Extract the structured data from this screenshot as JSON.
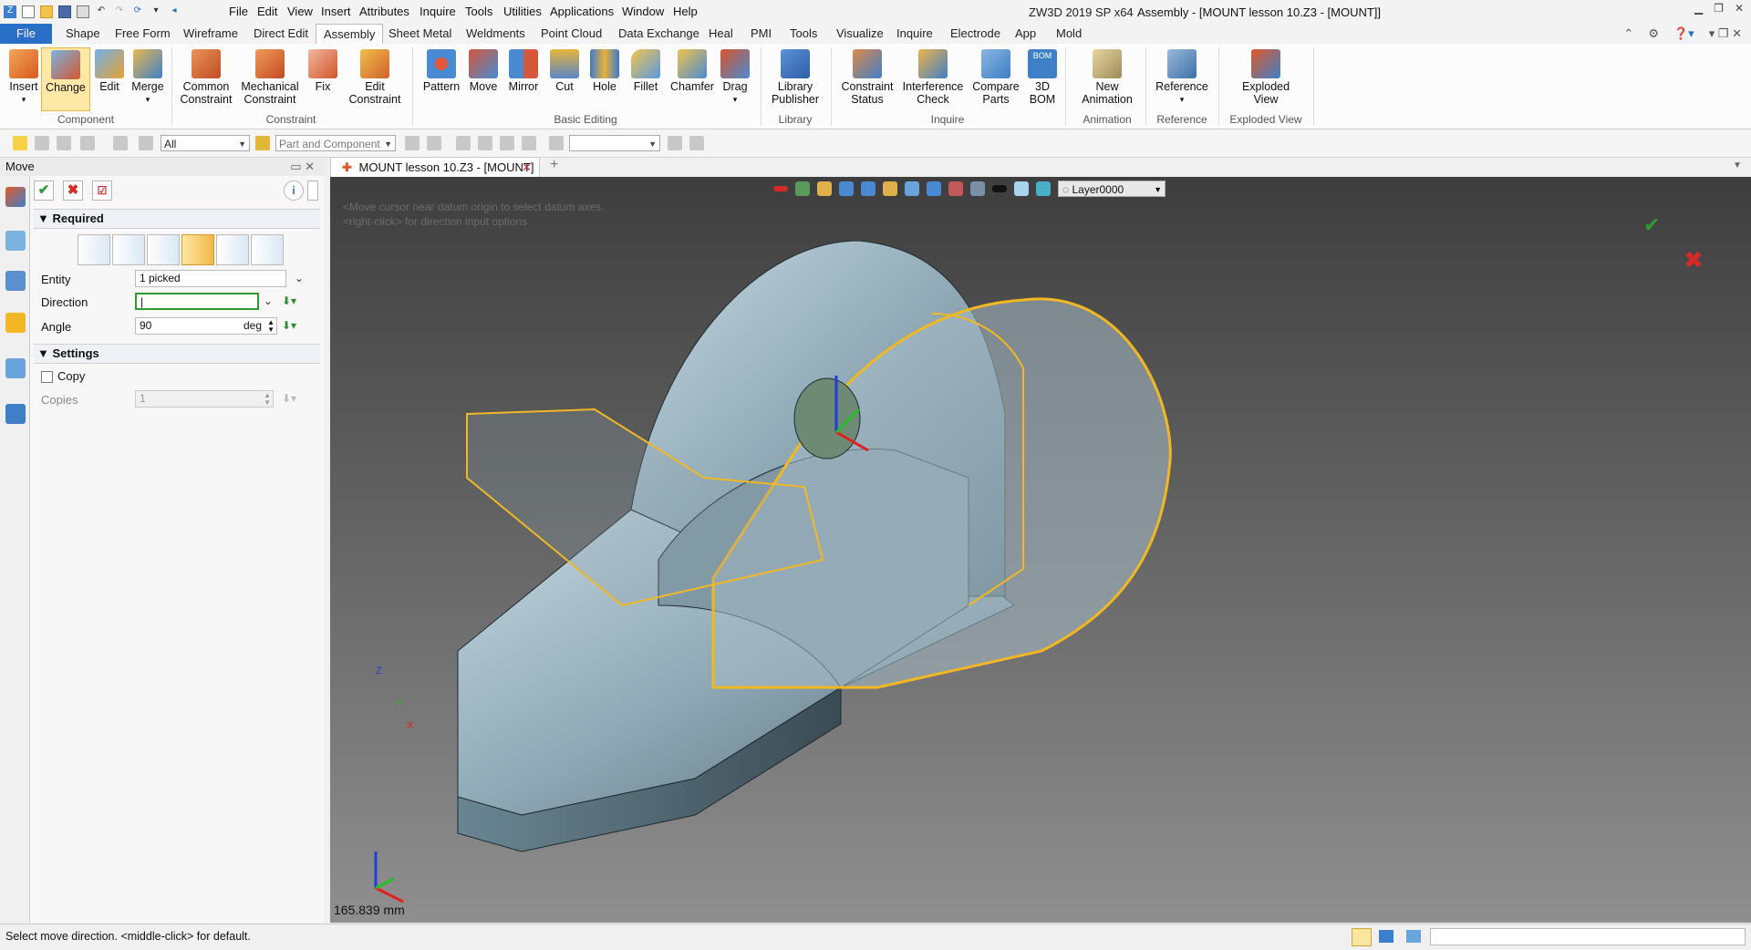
{
  "app": {
    "title": "ZW3D 2019 SP x64",
    "document_title": "Assembly - [MOUNT lesson 10.Z3 - [MOUNT]]"
  },
  "menubar": [
    "File",
    "Edit",
    "View",
    "Insert",
    "Attributes",
    "Inquire",
    "Tools",
    "Utilities",
    "Applications",
    "Window",
    "Help"
  ],
  "ribbon_tabs": [
    "File",
    "Shape",
    "Free Form",
    "Wireframe",
    "Direct Edit",
    "Assembly",
    "Sheet Metal",
    "Weldments",
    "Point Cloud",
    "Data Exchange",
    "Heal",
    "PMI",
    "Tools",
    "Visualize",
    "Inquire",
    "Electrode",
    "App",
    "Mold"
  ],
  "active_tab": "Assembly",
  "ribbon": {
    "component": {
      "label": "Component",
      "buttons": [
        "Insert",
        "Change",
        "Edit",
        "Merge"
      ]
    },
    "constraint": {
      "label": "Constraint",
      "buttons": [
        "Common\nConstraint",
        "Mechanical\nConstraint",
        "Fix",
        "Edit\nConstraint"
      ]
    },
    "basic_editing": {
      "label": "Basic Editing",
      "buttons": [
        "Pattern",
        "Move",
        "Mirror",
        "Cut",
        "Hole",
        "Fillet",
        "Chamfer",
        "Drag"
      ]
    },
    "library": {
      "label": "Library",
      "buttons": [
        "Library\nPublisher"
      ]
    },
    "inquire": {
      "label": "Inquire",
      "buttons": [
        "Constraint\nStatus",
        "Interference\nCheck",
        "Compare\nParts",
        "3D\nBOM"
      ]
    },
    "animation": {
      "label": "Animation",
      "buttons": [
        "New\nAnimation"
      ]
    },
    "reference": {
      "label": "Reference",
      "buttons": [
        "Reference"
      ]
    },
    "exploded_view": {
      "label": "Exploded View",
      "buttons": [
        "Exploded\nView"
      ]
    }
  },
  "toolbar2": {
    "filter_value": "All",
    "pick_mode": "Part and Component"
  },
  "panel": {
    "title": "Move",
    "required_label": "Required",
    "entity_label": "Entity",
    "entity_value": "1 picked",
    "direction_label": "Direction",
    "direction_value": "",
    "angle_label": "Angle",
    "angle_value": "90",
    "angle_unit": "deg",
    "settings_label": "Settings",
    "copy_label": "Copy",
    "copies_label": "Copies",
    "copies_value": "1"
  },
  "document_tab": "MOUNT lesson 10.Z3 - [MOUNT]",
  "viewport": {
    "layer": "Layer0000",
    "hint_line1": "<Move cursor near datum origin to select datum axes.",
    "hint_line2": "<right-click> for direction input options",
    "scale": "165.839 mm",
    "axis_x": "X",
    "axis_y": "Y",
    "axis_z": "Z"
  },
  "status": {
    "message": "Select move direction.  <middle-click> for default."
  },
  "colors": {
    "accent": "#2a6fc7",
    "model_fill": "#9fb7c3",
    "highlight": "#f2b824"
  }
}
